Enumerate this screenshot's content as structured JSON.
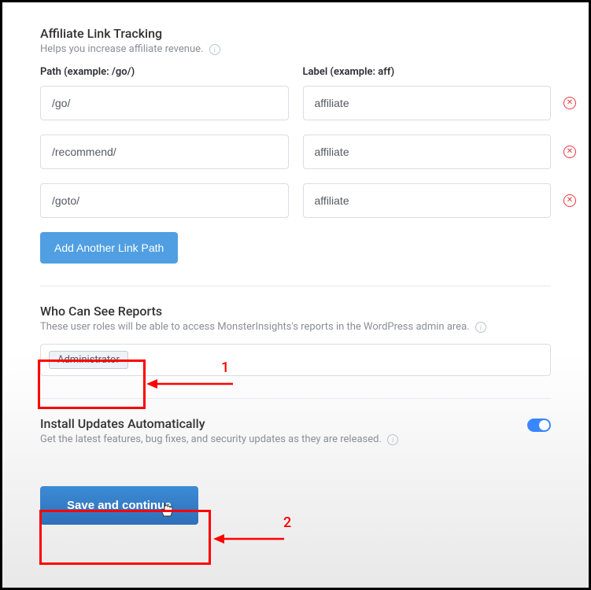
{
  "affiliateSection": {
    "title": "Affiliate Link Tracking",
    "desc": "Helps you increase affiliate revenue.",
    "headers": {
      "path": "Path (example: /go/)",
      "label": "Label (example: aff)"
    },
    "rows": [
      {
        "path": "/go/",
        "label": "affiliate"
      },
      {
        "path": "/recommend/",
        "label": "affiliate"
      },
      {
        "path": "/goto/",
        "label": "affiliate"
      }
    ],
    "addButton": "Add Another Link Path"
  },
  "reportsSection": {
    "title": "Who Can See Reports",
    "desc": "These user roles will be able to access MonsterInsights's reports in the WordPress admin area.",
    "roles": [
      "Administrator"
    ]
  },
  "updatesSection": {
    "title": "Install Updates Automatically",
    "desc": "Get the latest features, bug fixes, and security updates as they are released.",
    "enabled": true
  },
  "saveButton": "Save and continue",
  "annotations": {
    "one": "1",
    "two": "2"
  }
}
